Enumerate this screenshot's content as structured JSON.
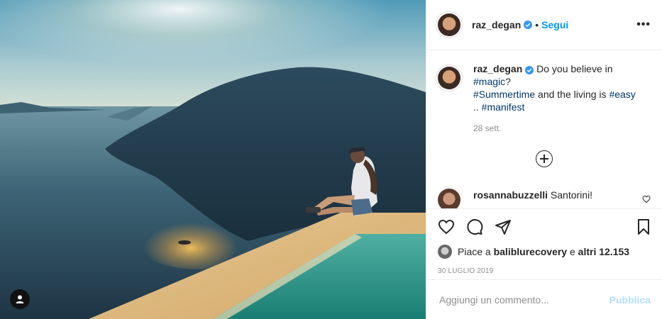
{
  "photo": {
    "alt_icon": "user-tag-icon"
  },
  "header": {
    "username": "raz_degan",
    "separator": "•",
    "follow_label": "Segui",
    "more_label": "•••"
  },
  "caption": {
    "username": "raz_degan",
    "text_1": "Do you believe in",
    "tag_magic": "#magic",
    "q": "?",
    "tag_summertime": "#Summertime",
    "text_2": "and the living is",
    "tag_easy": "#easy",
    "text_3": "..",
    "tag_manifest": "#manifest",
    "time": "28 sett."
  },
  "comments": [
    {
      "username": "rosannabuzzelli",
      "text": "Santorini!"
    }
  ],
  "likes": {
    "prefix": "Piace a",
    "user": "baliblurecovery",
    "joiner": "e",
    "others": "altri 12.153"
  },
  "date": "30 LUGLIO 2019",
  "add_comment": {
    "placeholder": "Aggiungi un commento...",
    "publish_label": "Pubblica"
  },
  "colors": {
    "link": "#0095f6",
    "hashtag": "#00376b",
    "verified": "#3897f0",
    "publish_disabled": "#b2dffc",
    "muted": "#8e8e8e"
  }
}
